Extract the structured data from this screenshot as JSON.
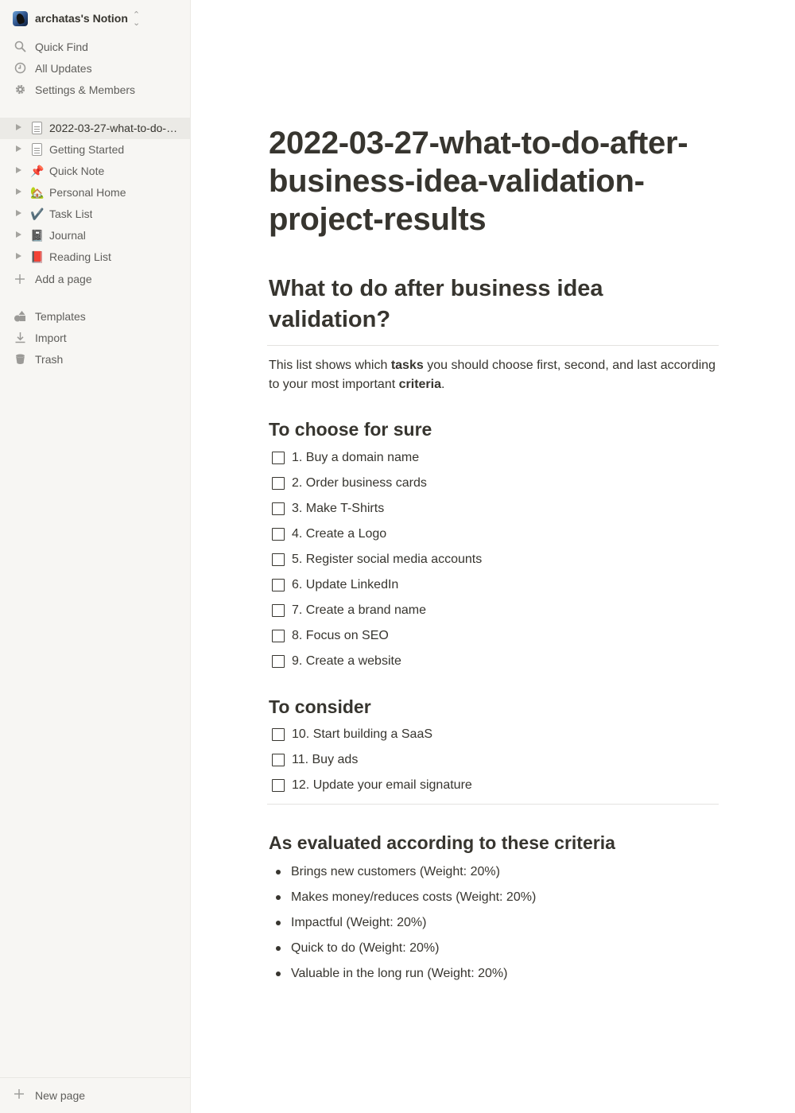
{
  "sidebar": {
    "workspace_name": "archatas's Notion",
    "nav": [
      {
        "label": "Quick Find",
        "icon": "search-icon"
      },
      {
        "label": "All Updates",
        "icon": "clock-icon"
      },
      {
        "label": "Settings & Members",
        "icon": "gear-icon"
      }
    ],
    "pages": [
      {
        "label": "2022-03-27-what-to-do-after-business-idea-validation-project-results",
        "icon": "page-icon",
        "active": true
      },
      {
        "label": "Getting Started",
        "icon": "page-icon"
      },
      {
        "label": "Quick Note",
        "icon": "pushpin-icon",
        "emoji": "📌"
      },
      {
        "label": "Personal Home",
        "icon": "house-icon",
        "emoji": "🏡"
      },
      {
        "label": "Task List",
        "icon": "check-icon",
        "emoji": "✔️"
      },
      {
        "label": "Journal",
        "icon": "notebook-icon",
        "emoji": "📓"
      },
      {
        "label": "Reading List",
        "icon": "book-icon",
        "emoji": "📕"
      }
    ],
    "add_page": "Add a page",
    "tools": [
      {
        "label": "Templates",
        "icon": "templates-icon"
      },
      {
        "label": "Import",
        "icon": "import-icon"
      },
      {
        "label": "Trash",
        "icon": "trash-icon"
      }
    ],
    "new_page": "New page"
  },
  "page": {
    "title": "2022-03-27-what-to-do-after-business-idea-validation-project-results",
    "heading": "What to do after business idea validation?",
    "intro": {
      "p1": "This list shows which ",
      "b1": "tasks",
      "p2": " you should choose first, second, and last according to your most important ",
      "b2": "criteria",
      "p3": "."
    },
    "section1": {
      "heading": "To choose for sure",
      "todos": [
        "1. Buy a domain name",
        "2. Order business cards",
        "3. Make T-Shirts",
        "4. Create a Logo",
        "5. Register social media accounts",
        "6. Update LinkedIn",
        "7. Create a brand name",
        "8. Focus on SEO",
        "9. Create a website"
      ]
    },
    "section2": {
      "heading": "To consider",
      "todos": [
        "10. Start building a SaaS",
        "11. Buy ads",
        "12. Update your email signature"
      ]
    },
    "section3": {
      "heading": "As evaluated according to these criteria",
      "bullets": [
        "Brings new customers (Weight: 20%)",
        "Makes money/reduces costs (Weight: 20%)",
        "Impactful (Weight: 20%)",
        "Quick to do (Weight: 20%)",
        "Valuable in the long run (Weight: 20%)"
      ]
    }
  }
}
